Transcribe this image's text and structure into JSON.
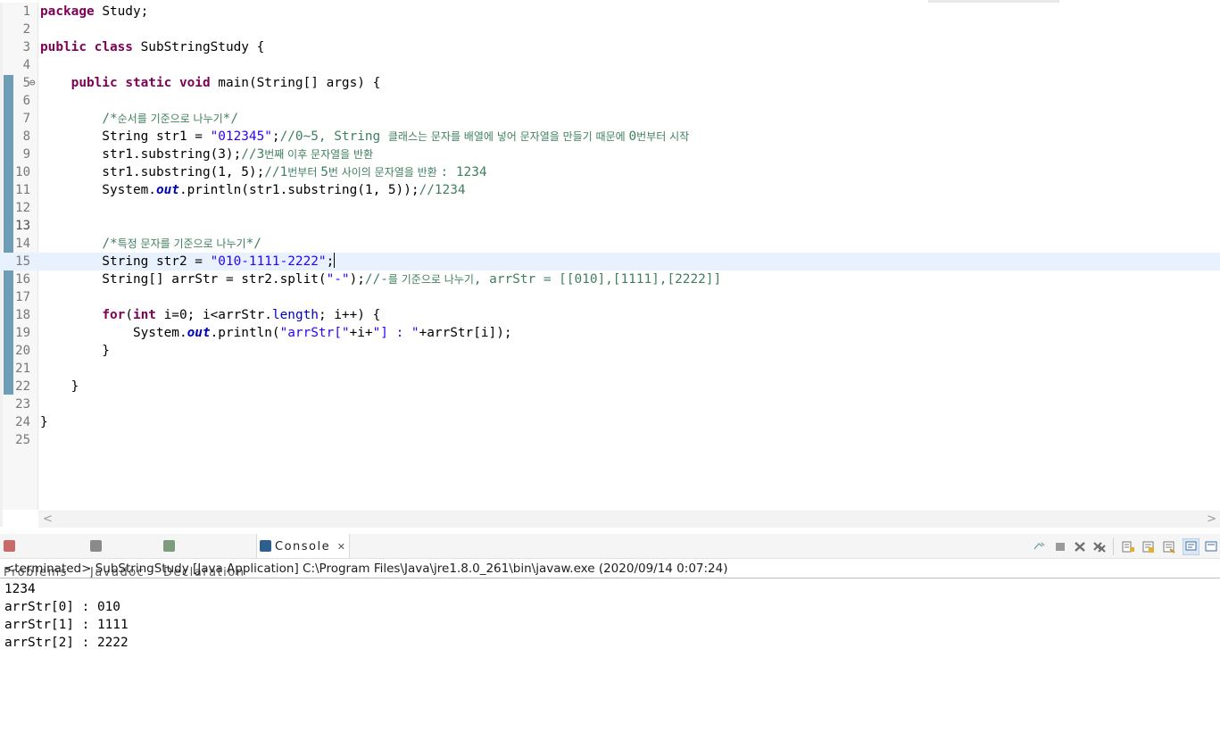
{
  "editor": {
    "lines": [
      {
        "num": "1",
        "tokens": [
          {
            "t": "kw",
            "v": "package"
          },
          {
            "t": "n",
            "v": " Study;"
          }
        ]
      },
      {
        "num": "2",
        "tokens": []
      },
      {
        "num": "3",
        "tokens": [
          {
            "t": "kw",
            "v": "public"
          },
          {
            "t": "n",
            "v": " "
          },
          {
            "t": "kw",
            "v": "class"
          },
          {
            "t": "n",
            "v": " SubStringStudy {"
          }
        ]
      },
      {
        "num": "4",
        "tokens": []
      },
      {
        "num": "5",
        "fold": "⊖",
        "tokens": [
          {
            "t": "n",
            "v": "    "
          },
          {
            "t": "kw",
            "v": "public"
          },
          {
            "t": "n",
            "v": " "
          },
          {
            "t": "kw",
            "v": "static"
          },
          {
            "t": "n",
            "v": " "
          },
          {
            "t": "kw",
            "v": "void"
          },
          {
            "t": "n",
            "v": " main(String[] "
          },
          {
            "t": "var",
            "v": "args"
          },
          {
            "t": "n",
            "v": ") {"
          }
        ]
      },
      {
        "num": "6",
        "tokens": []
      },
      {
        "num": "7",
        "tokens": [
          {
            "t": "n",
            "v": "        "
          },
          {
            "t": "cmt",
            "v": "/*"
          },
          {
            "t": "cmtko",
            "v": "순서를 기준으로 나누기"
          },
          {
            "t": "cmt",
            "v": "*/"
          }
        ]
      },
      {
        "num": "8",
        "tokens": [
          {
            "t": "n",
            "v": "        String str1 = "
          },
          {
            "t": "str",
            "v": "\"012345\""
          },
          {
            "t": "n",
            "v": ";"
          },
          {
            "t": "cmt",
            "v": "//0~5, String "
          },
          {
            "t": "cmtko",
            "v": "클래스는 문자를 배열에 넣어 문자열을 만들기 때문에 "
          },
          {
            "t": "cmt",
            "v": "0"
          },
          {
            "t": "cmtko",
            "v": "번부터 시작"
          }
        ]
      },
      {
        "num": "9",
        "tokens": [
          {
            "t": "n",
            "v": "        str1.substring(3);"
          },
          {
            "t": "cmt",
            "v": "//3"
          },
          {
            "t": "cmtko",
            "v": "번째 이후 문자열을 반환"
          }
        ]
      },
      {
        "num": "10",
        "tokens": [
          {
            "t": "n",
            "v": "        str1.substring(1, 5);"
          },
          {
            "t": "cmt",
            "v": "//1"
          },
          {
            "t": "cmtko",
            "v": "번부터 "
          },
          {
            "t": "cmt",
            "v": "5"
          },
          {
            "t": "cmtko",
            "v": "번 사이의 문자열을 반환 "
          },
          {
            "t": "cmt",
            "v": ": 1234"
          }
        ]
      },
      {
        "num": "11",
        "tokens": [
          {
            "t": "n",
            "v": "        System."
          },
          {
            "t": "sfield",
            "v": "out"
          },
          {
            "t": "n",
            "v": ".println(str1.substring(1, 5));"
          },
          {
            "t": "cmt",
            "v": "//1234"
          }
        ]
      },
      {
        "num": "12",
        "tokens": []
      },
      {
        "num": "13",
        "tokens": []
      },
      {
        "num": "14",
        "tokens": [
          {
            "t": "n",
            "v": "        "
          },
          {
            "t": "cmt",
            "v": "/*"
          },
          {
            "t": "cmtko",
            "v": "특정 문자를 기준으로 나누기"
          },
          {
            "t": "cmt",
            "v": "*/"
          }
        ]
      },
      {
        "num": "15",
        "current": true,
        "caret": true,
        "tokens": [
          {
            "t": "n",
            "v": "        String str2 = "
          },
          {
            "t": "str",
            "v": "\"010-1111-2222\""
          },
          {
            "t": "n",
            "v": ";"
          }
        ]
      },
      {
        "num": "16",
        "tokens": [
          {
            "t": "n",
            "v": "        String[] "
          },
          {
            "t": "var",
            "v": "arrStr"
          },
          {
            "t": "n",
            "v": " = str2.split("
          },
          {
            "t": "str",
            "v": "\"-\""
          },
          {
            "t": "n",
            "v": ");"
          },
          {
            "t": "cmt",
            "v": "//-"
          },
          {
            "t": "cmtko",
            "v": "를 기준으로 나누기"
          },
          {
            "t": "cmt",
            "v": ", arrStr = [[010],[1111],[2222]]"
          }
        ]
      },
      {
        "num": "17",
        "tokens": []
      },
      {
        "num": "18",
        "tokens": [
          {
            "t": "n",
            "v": "        "
          },
          {
            "t": "kw",
            "v": "for"
          },
          {
            "t": "n",
            "v": "("
          },
          {
            "t": "kw",
            "v": "int"
          },
          {
            "t": "n",
            "v": " i=0; i<arrStr."
          },
          {
            "t": "fld",
            "v": "length"
          },
          {
            "t": "n",
            "v": "; i++) {"
          }
        ]
      },
      {
        "num": "19",
        "tokens": [
          {
            "t": "n",
            "v": "            System."
          },
          {
            "t": "sfield",
            "v": "out"
          },
          {
            "t": "n",
            "v": ".println("
          },
          {
            "t": "str",
            "v": "\"arrStr[\""
          },
          {
            "t": "n",
            "v": "+i+"
          },
          {
            "t": "str",
            "v": "\"] : \""
          },
          {
            "t": "n",
            "v": "+arrStr[i]);"
          }
        ]
      },
      {
        "num": "20",
        "tokens": [
          {
            "t": "n",
            "v": "        }"
          }
        ]
      },
      {
        "num": "21",
        "tokens": []
      },
      {
        "num": "22",
        "tokens": [
          {
            "t": "n",
            "v": "    }"
          }
        ]
      },
      {
        "num": "23",
        "tokens": []
      },
      {
        "num": "24",
        "tokens": [
          {
            "t": "n",
            "v": "}"
          }
        ]
      },
      {
        "num": "25",
        "tokens": []
      }
    ],
    "active_line": "13",
    "scroll_left_arrow": "<",
    "scroll_right_arrow": ">"
  },
  "views": {
    "tabs": [
      {
        "label": "Problems",
        "icon": "problems-icon",
        "color": "#c86a6a",
        "active": false
      },
      {
        "label": "Javadoc",
        "icon": "javadoc-icon",
        "color": "#8a8a8a",
        "active": false
      },
      {
        "label": "Declaration",
        "icon": "declaration-icon",
        "color": "#7c9c7c",
        "active": false
      },
      {
        "label": "Console",
        "icon": "console-icon",
        "color": "#2f5f8f",
        "active": true
      }
    ],
    "close_glyph": "✕",
    "toolbar_icons": [
      "pin-console-icon",
      "terminate-icon",
      "remove-launch-icon",
      "remove-all-icon",
      "scroll-lock-icon",
      "word-wrap-icon",
      "show-on-output-icon",
      "display-selected-console-icon",
      "open-console-icon"
    ]
  },
  "console": {
    "status": "<terminated> SubStringStudy [Java Application] C:\\Program Files\\Java\\jre1.8.0_261\\bin\\javaw.exe (2020/09/14 0:07:24)",
    "output": [
      "1234",
      "arrStr[0] : 010",
      "arrStr[1] : 1111",
      "arrStr[2] : 2222"
    ]
  }
}
